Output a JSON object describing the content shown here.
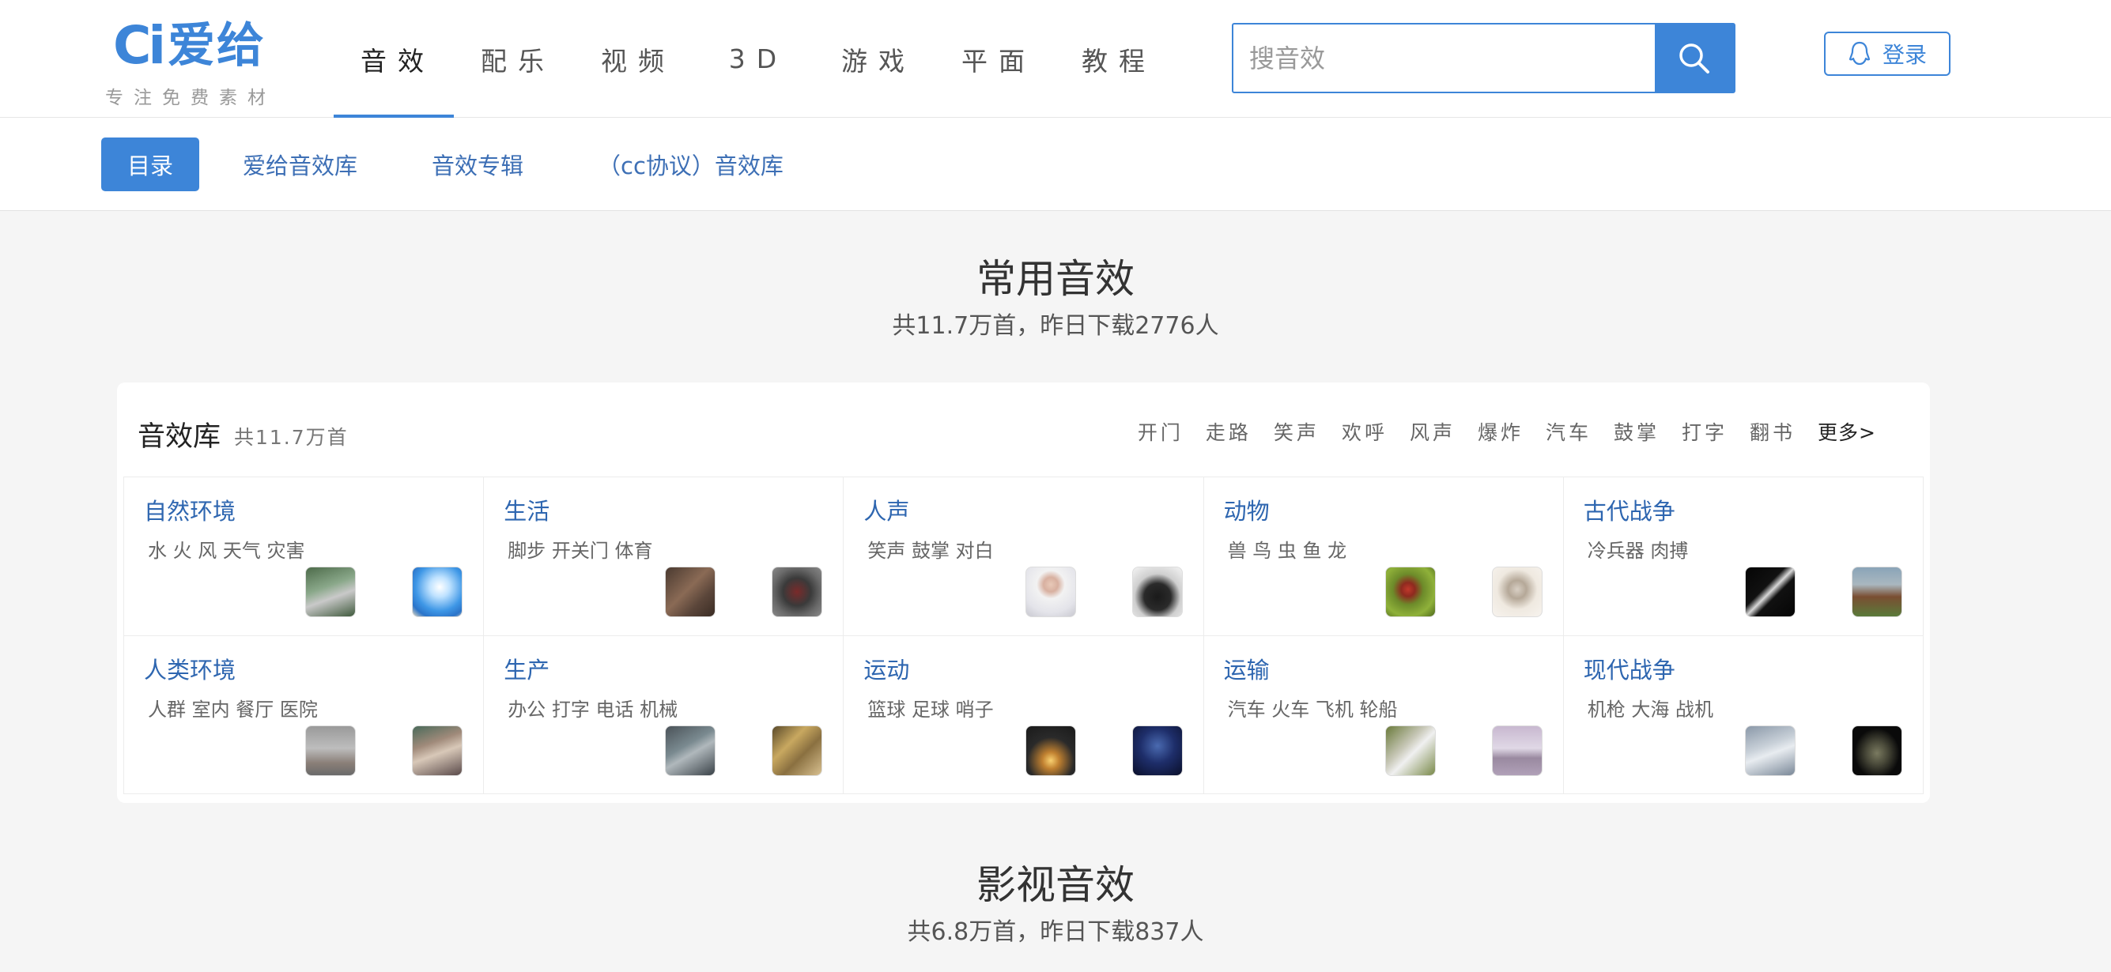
{
  "logo": {
    "mark": "Ci",
    "name": "爱给",
    "slogan": "专注免费素材"
  },
  "nav": [
    {
      "label": "音效",
      "active": true
    },
    {
      "label": "配乐"
    },
    {
      "label": "视频"
    },
    {
      "label": "3D"
    },
    {
      "label": "游戏"
    },
    {
      "label": "平面"
    },
    {
      "label": "教程"
    }
  ],
  "search": {
    "placeholder": "搜音效",
    "icon": "search-icon"
  },
  "login": {
    "label": "登录",
    "icon": "qq-penguin-icon"
  },
  "subnav": [
    {
      "label": "目录",
      "active": true
    },
    {
      "label": "爱给音效库"
    },
    {
      "label": "音效专辑"
    },
    {
      "label": "（cc协议）音效库"
    }
  ],
  "section1": {
    "title": "常用音效",
    "subtitle": "共11.7万首，昨日下载2776人"
  },
  "library": {
    "title": "音效库",
    "count": "共11.7万首",
    "tags": [
      "开门",
      "走路",
      "笑声",
      "欢呼",
      "风声",
      "爆炸",
      "汽车",
      "鼓掌",
      "打字",
      "翻书"
    ],
    "more": "更多>",
    "categories": [
      {
        "name": "自然环境",
        "keywords": "水 火 风 天气 灾害",
        "thumbs": [
          "forest-path-thumbnail",
          "sky-beach-thumbnail"
        ]
      },
      {
        "name": "生活",
        "keywords": "脚步 开关门 体育",
        "thumbs": [
          "hands-thumbnail",
          "motorcycle-thumbnail"
        ]
      },
      {
        "name": "人声",
        "keywords": "笑声 鼓掌 对白",
        "thumbs": [
          "person-portrait-thumbnail",
          "cheering-person-thumbnail"
        ]
      },
      {
        "name": "动物",
        "keywords": "兽 鸟 虫 鱼 龙",
        "thumbs": [
          "ladybug-thumbnail",
          "bird-thumbnail"
        ]
      },
      {
        "name": "古代战争",
        "keywords": "冷兵器 肉搏",
        "thumbs": [
          "sword-thumbnail",
          "horse-rider-thumbnail"
        ]
      },
      {
        "name": "人类环境",
        "keywords": "人群 室内 餐厅 医院",
        "thumbs": [
          "hallway-thumbnail",
          "crowd-thumbnail"
        ]
      },
      {
        "name": "生产",
        "keywords": "办公 打字 电话 机械",
        "thumbs": [
          "keyboard-thumbnail",
          "machinery-thumbnail"
        ]
      },
      {
        "name": "运动",
        "keywords": "篮球 足球 哨子",
        "thumbs": [
          "cyclist-sunset-thumbnail",
          "team-sports-thumbnail"
        ]
      },
      {
        "name": "运输",
        "keywords": "汽车 火车 飞机 轮船",
        "thumbs": [
          "train-thumbnail",
          "airplane-thumbnail"
        ]
      },
      {
        "name": "现代战争",
        "keywords": "机枪 大海 战机",
        "thumbs": [
          "fighter-jet-thumbnail",
          "tank-thumbnail"
        ]
      }
    ]
  },
  "section2": {
    "title": "影视音效",
    "subtitle": "共6.8万首，昨日下载837人"
  }
}
